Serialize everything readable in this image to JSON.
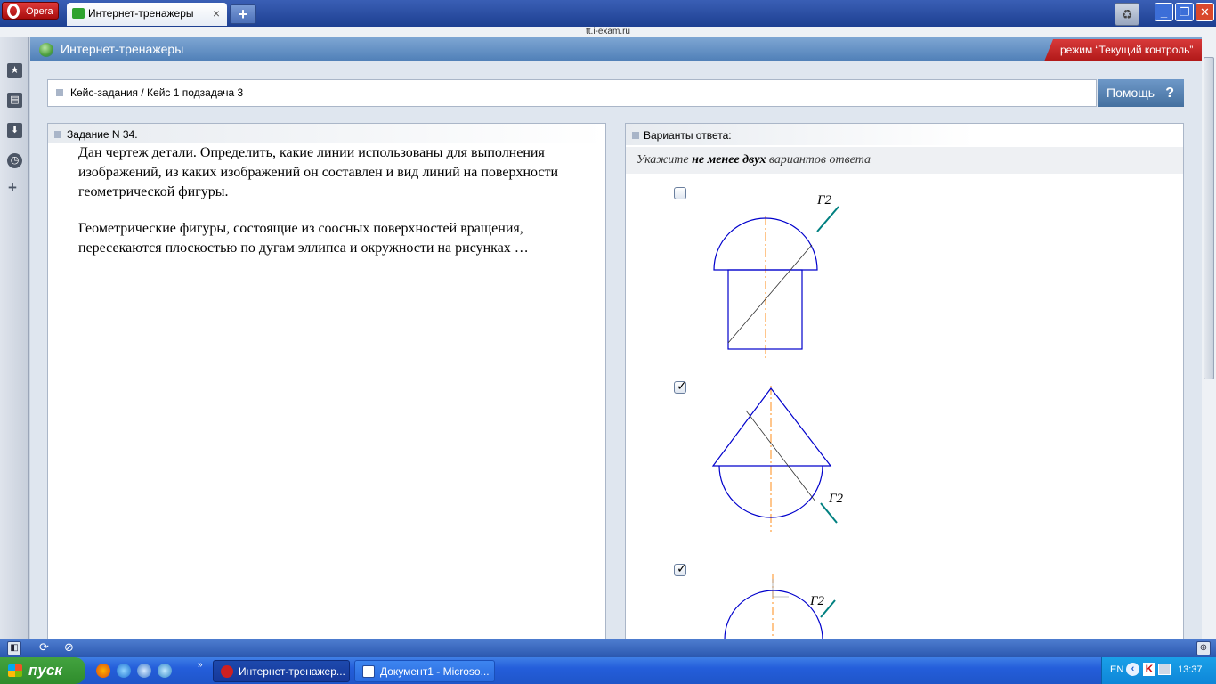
{
  "browser": {
    "menu_label": "Opera",
    "tab_title": "Интернет-тренажеры",
    "tab_close": "×",
    "new_tab": "+",
    "address": "tt.i-exam.ru",
    "win_min": "_",
    "win_max": "❐",
    "win_close": "✕"
  },
  "app": {
    "title": "Интернет-тренажеры",
    "mode": "режим “Текущий контроль”",
    "breadcrumb": "Кейс-задания / Кейс 1 подзадача 3",
    "help_label": "Помощь",
    "help_icon": "?"
  },
  "task": {
    "header": "Задание N 34.",
    "paragraph1": "Дан чертеж детали. Определить, какие линии использованы для выполнения изображений, из каких изображений он составлен и вид линий на поверхности геометрической фигуры.",
    "paragraph2": "Геометрические фигуры, состоящие из соосных поверхностей вращения, пересекаются плоскостью по дугам эллипса и окружности на рисунках …"
  },
  "answers": {
    "header": "Варианты ответа:",
    "instruction_pre": "Укажите ",
    "instruction_bold": "не менее двух",
    "instruction_post": " вариантов ответа",
    "plane_label": "Г2",
    "options": [
      {
        "checked": false
      },
      {
        "checked": true
      },
      {
        "checked": true
      }
    ]
  },
  "taskbar": {
    "start": "пуск",
    "tasks": [
      "Интернет-тренажер...",
      "Документ1 - Microso..."
    ],
    "lang": "EN",
    "clock": "13:37"
  },
  "colors": {
    "accent_blue": "#4f7fb7",
    "mode_red": "#c02323",
    "drawing_blue": "#0000cc",
    "axis_orange": "#ff8c1a",
    "trace_teal": "#008080"
  }
}
